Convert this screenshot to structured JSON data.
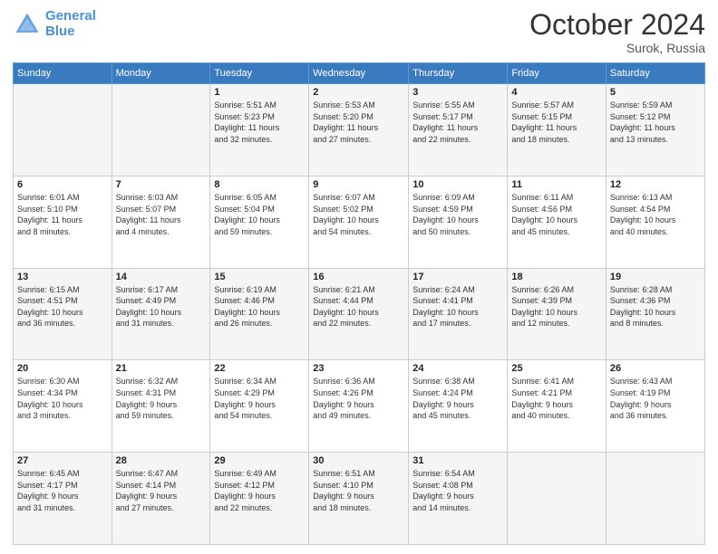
{
  "header": {
    "logo_line1": "General",
    "logo_line2": "Blue",
    "month": "October 2024",
    "location": "Surok, Russia"
  },
  "weekdays": [
    "Sunday",
    "Monday",
    "Tuesday",
    "Wednesday",
    "Thursday",
    "Friday",
    "Saturday"
  ],
  "weeks": [
    [
      {
        "day": "",
        "info": ""
      },
      {
        "day": "",
        "info": ""
      },
      {
        "day": "1",
        "info": "Sunrise: 5:51 AM\nSunset: 5:23 PM\nDaylight: 11 hours\nand 32 minutes."
      },
      {
        "day": "2",
        "info": "Sunrise: 5:53 AM\nSunset: 5:20 PM\nDaylight: 11 hours\nand 27 minutes."
      },
      {
        "day": "3",
        "info": "Sunrise: 5:55 AM\nSunset: 5:17 PM\nDaylight: 11 hours\nand 22 minutes."
      },
      {
        "day": "4",
        "info": "Sunrise: 5:57 AM\nSunset: 5:15 PM\nDaylight: 11 hours\nand 18 minutes."
      },
      {
        "day": "5",
        "info": "Sunrise: 5:59 AM\nSunset: 5:12 PM\nDaylight: 11 hours\nand 13 minutes."
      }
    ],
    [
      {
        "day": "6",
        "info": "Sunrise: 6:01 AM\nSunset: 5:10 PM\nDaylight: 11 hours\nand 8 minutes."
      },
      {
        "day": "7",
        "info": "Sunrise: 6:03 AM\nSunset: 5:07 PM\nDaylight: 11 hours\nand 4 minutes."
      },
      {
        "day": "8",
        "info": "Sunrise: 6:05 AM\nSunset: 5:04 PM\nDaylight: 10 hours\nand 59 minutes."
      },
      {
        "day": "9",
        "info": "Sunrise: 6:07 AM\nSunset: 5:02 PM\nDaylight: 10 hours\nand 54 minutes."
      },
      {
        "day": "10",
        "info": "Sunrise: 6:09 AM\nSunset: 4:59 PM\nDaylight: 10 hours\nand 50 minutes."
      },
      {
        "day": "11",
        "info": "Sunrise: 6:11 AM\nSunset: 4:56 PM\nDaylight: 10 hours\nand 45 minutes."
      },
      {
        "day": "12",
        "info": "Sunrise: 6:13 AM\nSunset: 4:54 PM\nDaylight: 10 hours\nand 40 minutes."
      }
    ],
    [
      {
        "day": "13",
        "info": "Sunrise: 6:15 AM\nSunset: 4:51 PM\nDaylight: 10 hours\nand 36 minutes."
      },
      {
        "day": "14",
        "info": "Sunrise: 6:17 AM\nSunset: 4:49 PM\nDaylight: 10 hours\nand 31 minutes."
      },
      {
        "day": "15",
        "info": "Sunrise: 6:19 AM\nSunset: 4:46 PM\nDaylight: 10 hours\nand 26 minutes."
      },
      {
        "day": "16",
        "info": "Sunrise: 6:21 AM\nSunset: 4:44 PM\nDaylight: 10 hours\nand 22 minutes."
      },
      {
        "day": "17",
        "info": "Sunrise: 6:24 AM\nSunset: 4:41 PM\nDaylight: 10 hours\nand 17 minutes."
      },
      {
        "day": "18",
        "info": "Sunrise: 6:26 AM\nSunset: 4:39 PM\nDaylight: 10 hours\nand 12 minutes."
      },
      {
        "day": "19",
        "info": "Sunrise: 6:28 AM\nSunset: 4:36 PM\nDaylight: 10 hours\nand 8 minutes."
      }
    ],
    [
      {
        "day": "20",
        "info": "Sunrise: 6:30 AM\nSunset: 4:34 PM\nDaylight: 10 hours\nand 3 minutes."
      },
      {
        "day": "21",
        "info": "Sunrise: 6:32 AM\nSunset: 4:31 PM\nDaylight: 9 hours\nand 59 minutes."
      },
      {
        "day": "22",
        "info": "Sunrise: 6:34 AM\nSunset: 4:29 PM\nDaylight: 9 hours\nand 54 minutes."
      },
      {
        "day": "23",
        "info": "Sunrise: 6:36 AM\nSunset: 4:26 PM\nDaylight: 9 hours\nand 49 minutes."
      },
      {
        "day": "24",
        "info": "Sunrise: 6:38 AM\nSunset: 4:24 PM\nDaylight: 9 hours\nand 45 minutes."
      },
      {
        "day": "25",
        "info": "Sunrise: 6:41 AM\nSunset: 4:21 PM\nDaylight: 9 hours\nand 40 minutes."
      },
      {
        "day": "26",
        "info": "Sunrise: 6:43 AM\nSunset: 4:19 PM\nDaylight: 9 hours\nand 36 minutes."
      }
    ],
    [
      {
        "day": "27",
        "info": "Sunrise: 6:45 AM\nSunset: 4:17 PM\nDaylight: 9 hours\nand 31 minutes."
      },
      {
        "day": "28",
        "info": "Sunrise: 6:47 AM\nSunset: 4:14 PM\nDaylight: 9 hours\nand 27 minutes."
      },
      {
        "day": "29",
        "info": "Sunrise: 6:49 AM\nSunset: 4:12 PM\nDaylight: 9 hours\nand 22 minutes."
      },
      {
        "day": "30",
        "info": "Sunrise: 6:51 AM\nSunset: 4:10 PM\nDaylight: 9 hours\nand 18 minutes."
      },
      {
        "day": "31",
        "info": "Sunrise: 6:54 AM\nSunset: 4:08 PM\nDaylight: 9 hours\nand 14 minutes."
      },
      {
        "day": "",
        "info": ""
      },
      {
        "day": "",
        "info": ""
      }
    ]
  ]
}
